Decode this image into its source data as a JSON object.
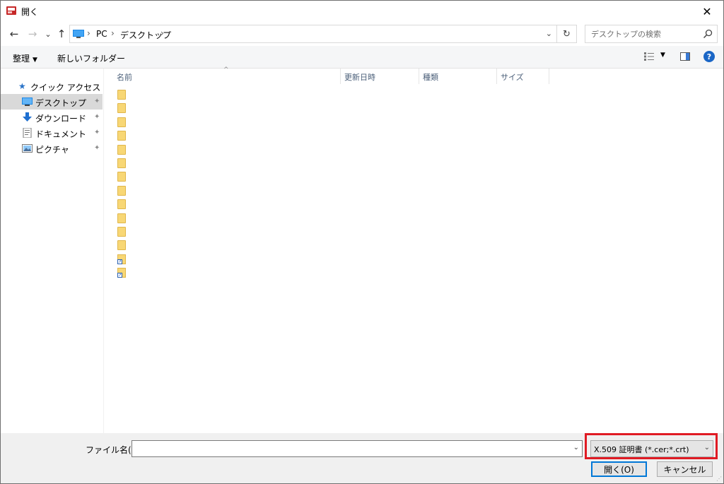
{
  "window": {
    "title": "開く",
    "close_label": "✕"
  },
  "nav": {
    "back": "←",
    "forward": "→",
    "recent": "⌄",
    "up": "↑"
  },
  "address": {
    "crumbs": [
      "PC",
      "デスクトップ"
    ],
    "separator": "›",
    "dropdown": "⌄",
    "refresh": "↻"
  },
  "search": {
    "placeholder": "デスクトップの検索"
  },
  "toolbar": {
    "organize_label": "整理",
    "organize_arrow": "▼",
    "new_folder_label": "新しいフォルダー",
    "view_arrow": "▼",
    "help_label": "?"
  },
  "sidebar": {
    "quick_access": "クイック アクセス",
    "items": [
      {
        "label": "デスクトップ",
        "icon": "desktop-icon",
        "pinned": true,
        "selected": true
      },
      {
        "label": "ダウンロード",
        "icon": "download-icon",
        "pinned": true,
        "selected": false
      },
      {
        "label": "ドキュメント",
        "icon": "document-icon",
        "pinned": true,
        "selected": false
      },
      {
        "label": "ピクチャ",
        "icon": "picture-icon",
        "pinned": true,
        "selected": false
      }
    ],
    "pin_glyph": "📌"
  },
  "filelist": {
    "columns": [
      "名前",
      "更新日時",
      "種類",
      "サイズ"
    ],
    "sort_arrow": "^",
    "items": [
      "folder",
      "folder",
      "folder",
      "folder",
      "folder",
      "folder",
      "folder",
      "folder",
      "folder",
      "folder",
      "folder",
      "folder",
      "shortcut",
      "shortcut"
    ]
  },
  "footer": {
    "filename_label": "ファイル名(N):",
    "filename_value": "",
    "filter_value": "X.509 証明書 (*.cer;*.crt)",
    "open_label": "開く(O)",
    "cancel_label": "キャンセル"
  },
  "colors": {
    "highlight": "#e01b24",
    "accent": "#0078d7",
    "folder": "#f8d775"
  }
}
